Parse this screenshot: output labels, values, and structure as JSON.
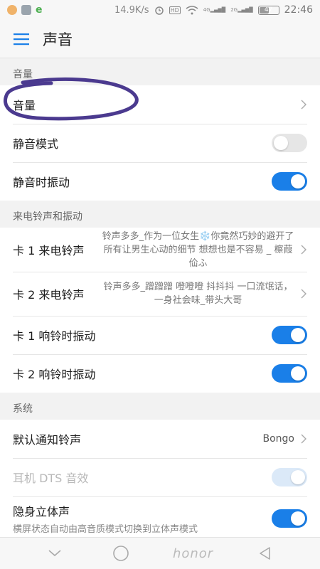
{
  "status_bar": {
    "speed": "14.9K/s",
    "net1": "4G",
    "net2": "2G",
    "battery": "47",
    "time": "22:46"
  },
  "app_bar": {
    "title": "声音"
  },
  "sections": {
    "volume": {
      "header": "音量",
      "volume_label": "音量",
      "silent_label": "静音模式",
      "silent_vibrate_label": "静音时振动"
    },
    "ringtone": {
      "header": "来电铃声和振动",
      "card1_label": "卡 1 来电铃声",
      "card1_value": "铃声多多_作为一位女生❄️你竟然巧妙的避开了所有让男生心动的细节 想想也是不容易 _ 檫葭佡ふ",
      "card2_label": "卡 2 来电铃声",
      "card2_value": "铃声多多_蹭蹭蹭 噔噔噔 抖抖抖 一口流氓话，一身社会味_带头大哥",
      "card1_vibrate_label": "卡 1 响铃时振动",
      "card2_vibrate_label": "卡 2 响铃时振动"
    },
    "system": {
      "header": "系统",
      "notify_label": "默认通知铃声",
      "notify_value": "Bongo",
      "dts_label": "耳机 DTS 音效",
      "stereo_label": "隐身立体声",
      "stereo_desc": "横屏状态自动由高音质模式切换到立体声模式"
    }
  },
  "toggles": {
    "silent_mode": false,
    "silent_vibrate": true,
    "card1_vibrate": true,
    "card2_vibrate": true,
    "dts": true,
    "stereo": true
  },
  "nav_bar": {
    "brand": "honor"
  },
  "colors": {
    "accent": "#1a7fe8",
    "annotation": "#4b3a8f"
  }
}
